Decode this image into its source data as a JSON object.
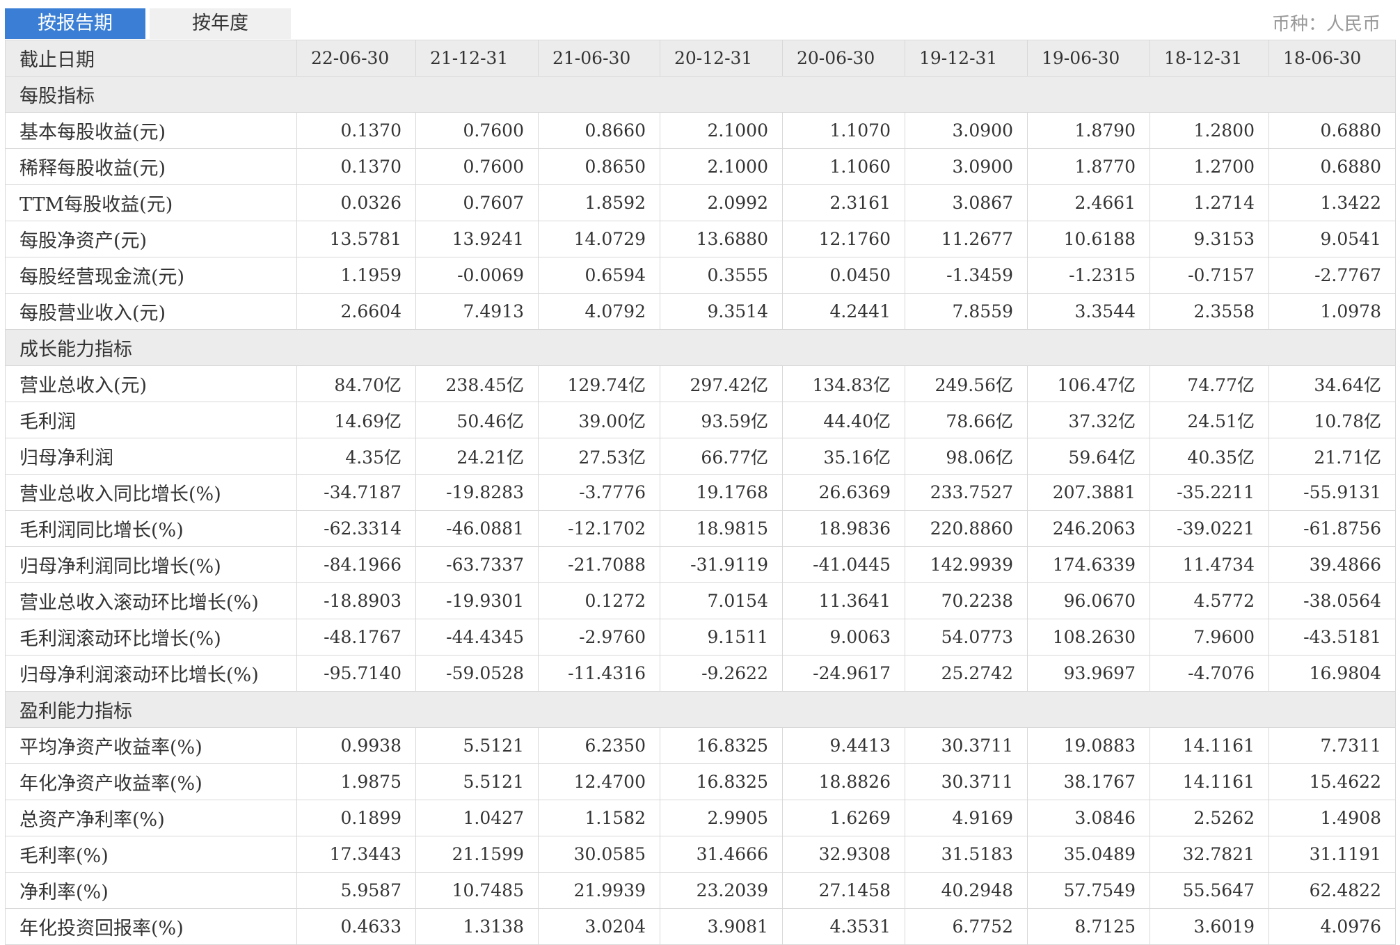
{
  "tabs": [
    {
      "label": "按报告期",
      "active": true
    },
    {
      "label": "按年度",
      "active": false
    }
  ],
  "currency": "币种：人民币",
  "header": {
    "label": "截止日期",
    "dates": [
      "22-06-30",
      "21-12-31",
      "21-06-30",
      "20-12-31",
      "20-06-30",
      "19-12-31",
      "19-06-30",
      "18-12-31",
      "18-06-30"
    ]
  },
  "sections": [
    {
      "title": "每股指标",
      "rows": [
        {
          "label": "基本每股收益(元)",
          "values": [
            "0.1370",
            "0.7600",
            "0.8660",
            "2.1000",
            "1.1070",
            "3.0900",
            "1.8790",
            "1.2800",
            "0.6880"
          ]
        },
        {
          "label": "稀释每股收益(元)",
          "values": [
            "0.1370",
            "0.7600",
            "0.8650",
            "2.1000",
            "1.1060",
            "3.0900",
            "1.8770",
            "1.2700",
            "0.6880"
          ]
        },
        {
          "label": "TTM每股收益(元)",
          "values": [
            "0.0326",
            "0.7607",
            "1.8592",
            "2.0992",
            "2.3161",
            "3.0867",
            "2.4661",
            "1.2714",
            "1.3422"
          ]
        },
        {
          "label": "每股净资产(元)",
          "values": [
            "13.5781",
            "13.9241",
            "14.0729",
            "13.6880",
            "12.1760",
            "11.2677",
            "10.6188",
            "9.3153",
            "9.0541"
          ]
        },
        {
          "label": "每股经营现金流(元)",
          "values": [
            "1.1959",
            "-0.0069",
            "0.6594",
            "0.3555",
            "0.0450",
            "-1.3459",
            "-1.2315",
            "-0.7157",
            "-2.7767"
          ]
        },
        {
          "label": "每股营业收入(元)",
          "values": [
            "2.6604",
            "7.4913",
            "4.0792",
            "9.3514",
            "4.2441",
            "7.8559",
            "3.3544",
            "2.3558",
            "1.0978"
          ]
        }
      ]
    },
    {
      "title": "成长能力指标",
      "rows": [
        {
          "label": "营业总收入(元)",
          "values": [
            "84.70亿",
            "238.45亿",
            "129.74亿",
            "297.42亿",
            "134.83亿",
            "249.56亿",
            "106.47亿",
            "74.77亿",
            "34.64亿"
          ]
        },
        {
          "label": "毛利润",
          "values": [
            "14.69亿",
            "50.46亿",
            "39.00亿",
            "93.59亿",
            "44.40亿",
            "78.66亿",
            "37.32亿",
            "24.51亿",
            "10.78亿"
          ]
        },
        {
          "label": "归母净利润",
          "values": [
            "4.35亿",
            "24.21亿",
            "27.53亿",
            "66.77亿",
            "35.16亿",
            "98.06亿",
            "59.64亿",
            "40.35亿",
            "21.71亿"
          ]
        },
        {
          "label": "营业总收入同比增长(%)",
          "values": [
            "-34.7187",
            "-19.8283",
            "-3.7776",
            "19.1768",
            "26.6369",
            "233.7527",
            "207.3881",
            "-35.2211",
            "-55.9131"
          ]
        },
        {
          "label": "毛利润同比增长(%)",
          "values": [
            "-62.3314",
            "-46.0881",
            "-12.1702",
            "18.9815",
            "18.9836",
            "220.8860",
            "246.2063",
            "-39.0221",
            "-61.8756"
          ]
        },
        {
          "label": "归母净利润同比增长(%)",
          "values": [
            "-84.1966",
            "-63.7337",
            "-21.7088",
            "-31.9119",
            "-41.0445",
            "142.9939",
            "174.6339",
            "11.4734",
            "39.4866"
          ]
        },
        {
          "label": "营业总收入滚动环比增长(%)",
          "values": [
            "-18.8903",
            "-19.9301",
            "0.1272",
            "7.0154",
            "11.3641",
            "70.2238",
            "96.0670",
            "4.5772",
            "-38.0564"
          ]
        },
        {
          "label": "毛利润滚动环比增长(%)",
          "values": [
            "-48.1767",
            "-44.4345",
            "-2.9760",
            "9.1511",
            "9.0063",
            "54.0773",
            "108.2630",
            "7.9600",
            "-43.5181"
          ]
        },
        {
          "label": "归母净利润滚动环比增长(%)",
          "values": [
            "-95.7140",
            "-59.0528",
            "-11.4316",
            "-9.2622",
            "-24.9617",
            "25.2742",
            "93.9697",
            "-4.7076",
            "16.9804"
          ]
        }
      ]
    },
    {
      "title": "盈利能力指标",
      "rows": [
        {
          "label": "平均净资产收益率(%)",
          "values": [
            "0.9938",
            "5.5121",
            "6.2350",
            "16.8325",
            "9.4413",
            "30.3711",
            "19.0883",
            "14.1161",
            "7.7311"
          ]
        },
        {
          "label": "年化净资产收益率(%)",
          "values": [
            "1.9875",
            "5.5121",
            "12.4700",
            "16.8325",
            "18.8826",
            "30.3711",
            "38.1767",
            "14.1161",
            "15.4622"
          ]
        },
        {
          "label": "总资产净利率(%)",
          "values": [
            "0.1899",
            "1.0427",
            "1.1582",
            "2.9905",
            "1.6269",
            "4.9169",
            "3.0846",
            "2.5262",
            "1.4908"
          ]
        },
        {
          "label": "毛利率(%)",
          "values": [
            "17.3443",
            "21.1599",
            "30.0585",
            "31.4666",
            "32.9308",
            "31.5183",
            "35.0489",
            "32.7821",
            "31.1191"
          ]
        },
        {
          "label": "净利率(%)",
          "values": [
            "5.9587",
            "10.7485",
            "21.9939",
            "23.2039",
            "27.1458",
            "40.2948",
            "57.7549",
            "55.5647",
            "62.4822"
          ]
        },
        {
          "label": "年化投资回报率(%)",
          "values": [
            "0.4633",
            "1.3138",
            "3.0204",
            "3.9081",
            "4.3531",
            "6.7752",
            "8.7125",
            "3.6019",
            "4.0976"
          ]
        }
      ]
    }
  ]
}
